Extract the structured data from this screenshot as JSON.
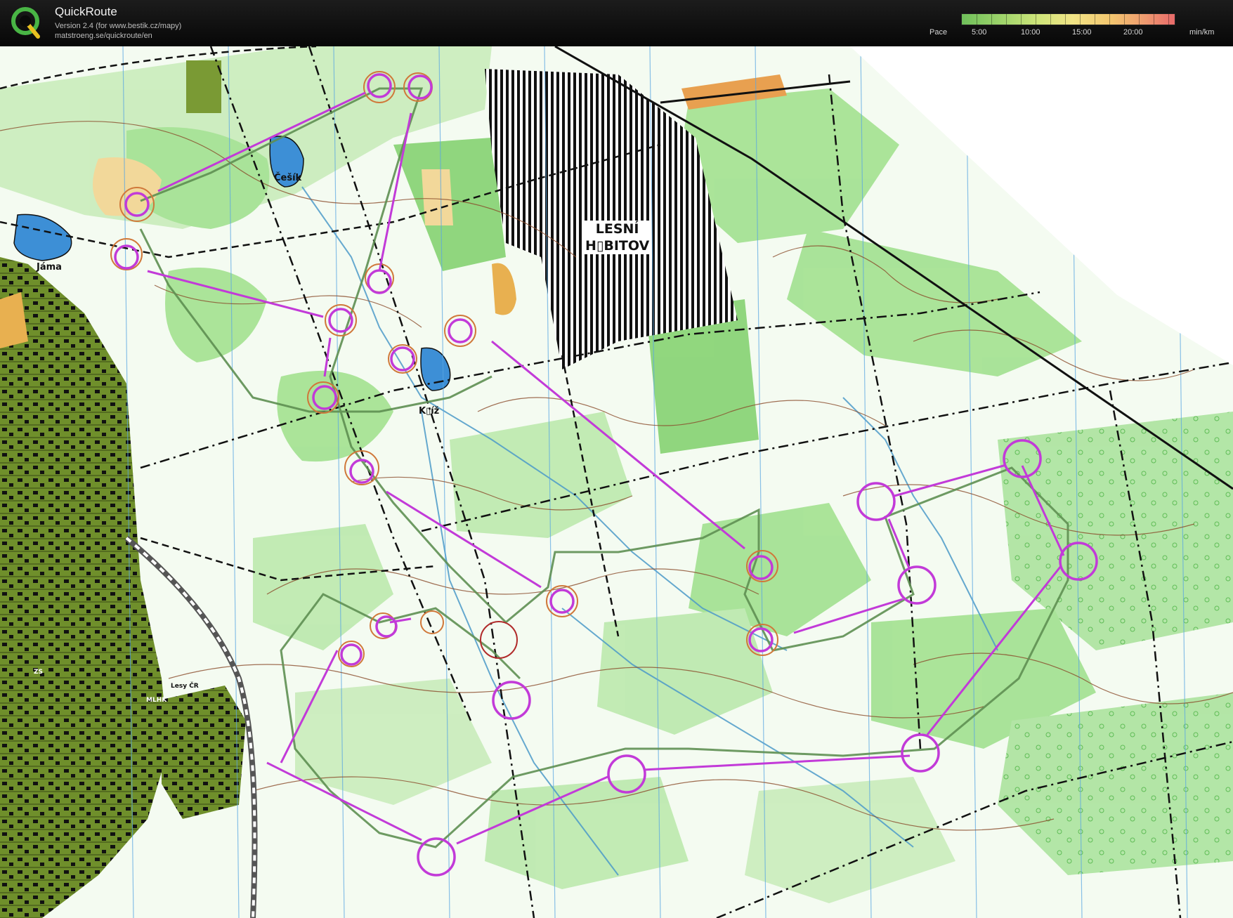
{
  "app": {
    "name": "QuickRoute",
    "version": "Version 2.4  (for www.bestik.cz/mapy)",
    "url": "matstroeng.se/quickroute/en"
  },
  "pace_scale": {
    "label": "Pace",
    "ticks": [
      "5:00",
      "10:00",
      "15:00",
      "20:00"
    ],
    "unit": "min/km"
  },
  "map_labels": {
    "cesik": "Češík",
    "jama": "Jáma",
    "kriz": "K▯íž",
    "cemetery_line1": "LESNÍ",
    "cemetery_line2": "H▯BITOV",
    "lesy_cr": "Lesy ČR",
    "mlhk": "MLHK",
    "zs": "ZS"
  },
  "colors": {
    "course": "#c23ad8",
    "route": "#5e8f52",
    "white_forest": "#ffffff",
    "green_forest": "#9ddf8a",
    "urban": "#6f8f2b",
    "water": "#3d8fd6",
    "contour": "#8a4b2a"
  }
}
